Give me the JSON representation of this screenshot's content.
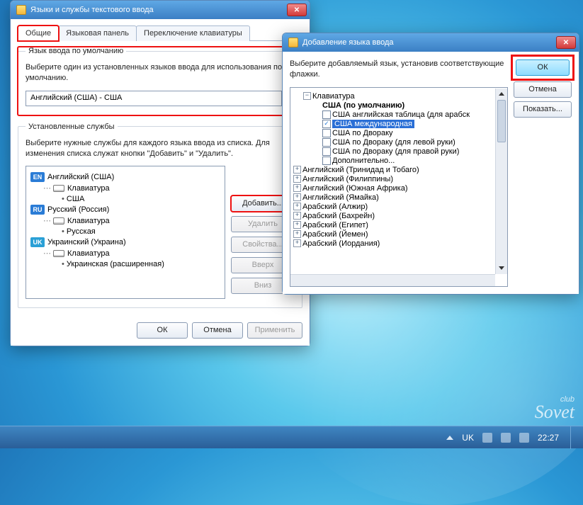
{
  "dlg1": {
    "title": "Языки и службы текстового ввода",
    "tabs": {
      "general": "Общие",
      "langbar": "Языковая панель",
      "switch": "Переключение клавиатуры"
    },
    "default_group": {
      "legend": "Язык ввода по умолчанию",
      "desc": "Выберите один из установленных языков ввода для использования по умолчанию.",
      "value": "Английский (США) - США"
    },
    "installed_group": {
      "legend": "Установленные службы",
      "desc": "Выберите нужные службы для каждого языка ввода из списка. Для изменения списка служат кнопки \"Добавить\" и \"Удалить\".",
      "langs": [
        {
          "code": "EN",
          "name": "Английский (США)",
          "kb_label": "Клавиатура",
          "layouts": [
            "США"
          ]
        },
        {
          "code": "RU",
          "name": "Русский (Россия)",
          "kb_label": "Клавиатура",
          "layouts": [
            "Русская"
          ]
        },
        {
          "code": "UK",
          "name": "Украинский (Украина)",
          "kb_label": "Клавиатура",
          "layouts": [
            "Украинская (расширенная)"
          ]
        }
      ],
      "buttons": {
        "add": "Добавить...",
        "remove": "Удалить",
        "props": "Свойства...",
        "up": "Вверх",
        "down": "Вниз"
      }
    },
    "footer": {
      "ok": "ОК",
      "cancel": "Отмена",
      "apply": "Применить"
    }
  },
  "dlg2": {
    "title": "Добавление языка ввода",
    "desc": "Выберите добавляемый язык, установив соответствующие флажки.",
    "kb_root": "Клавиатура",
    "default_line": "США (по умолчанию)",
    "checks": [
      {
        "label": "США английская таблица (для арабск",
        "checked": false
      },
      {
        "label": "США международная",
        "checked": true,
        "selected": true
      },
      {
        "label": "США по Двораку",
        "checked": false
      },
      {
        "label": "США по Двораку (для левой руки)",
        "checked": false
      },
      {
        "label": "США по Двораку (для правой руки)",
        "checked": false
      },
      {
        "label": "Дополнительно...",
        "checked": false
      }
    ],
    "collapsed": [
      "Английский (Тринидад и Тобаго)",
      "Английский (Филиппины)",
      "Английский (Южная Африка)",
      "Английский (Ямайка)",
      "Арабский (Алжир)",
      "Арабский (Бахрейн)",
      "Арабский (Египет)",
      "Арабский (Йемен)",
      "Арабский (Иордания)"
    ],
    "buttons": {
      "ok": "ОК",
      "cancel": "Отмена",
      "show": "Показать..."
    }
  },
  "taskbar": {
    "lang": "UK",
    "time": "22:27"
  },
  "watermark": {
    "l1": "club",
    "l2": "Sovet"
  }
}
